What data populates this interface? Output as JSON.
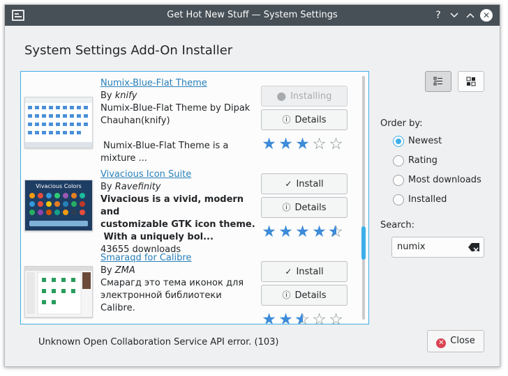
{
  "window": {
    "title": "Get Hot New Stuff — System Settings",
    "help_icon": "?",
    "minimize_icon": "﹀",
    "maximize_icon": "︿",
    "close_icon": "✕"
  },
  "dialog": {
    "title": "System Settings Add-On Installer"
  },
  "items": [
    {
      "name": "Numix-Blue-Flat Theme",
      "author_prefix": "By ",
      "author": "knify",
      "description_line1": "Numix-Blue-Flat Theme by Dipak",
      "description_line2": "Chauhan(knify)",
      "description_line3": "Numix-Blue-Flat Theme is a",
      "description_line4": "mixture ...",
      "primary_button": "Installing",
      "details_button": "Details",
      "rating_stars": 3.0
    },
    {
      "name": "Vivacious Icon Suite",
      "author_prefix": "By ",
      "author": "Ravefinity",
      "description_line1": "Vivacious is a vivid, modern and",
      "description_line2": "customizable GTK icon theme.",
      "description_line3": " With a uniquely bol...",
      "downloads": "43655 downloads",
      "primary_button": "Install",
      "details_button": "Details",
      "rating_stars": 4.5
    },
    {
      "name": "Smaraqd for Calibre",
      "author_prefix": "By ",
      "author": "ZMA",
      "description_line1": "Смарагд это тема иконок для",
      "description_line2": "электронной библиотеки",
      "description_line3": "Calibre.",
      "primary_button": "Install",
      "details_button": "Details",
      "rating_stars": 2.5
    }
  ],
  "order": {
    "label": "Order by:",
    "options": [
      "Newest",
      "Rating",
      "Most downloads",
      "Installed"
    ],
    "selected": "Newest"
  },
  "search": {
    "label": "Search:",
    "value": "numix"
  },
  "status_text": "Unknown Open Collaboration Service API error. (103)",
  "close_button": "Close",
  "colors": {
    "accent": "#3daee9",
    "star": "#3d8bd9",
    "titlebar": "#475057",
    "link": "#2980b9"
  }
}
